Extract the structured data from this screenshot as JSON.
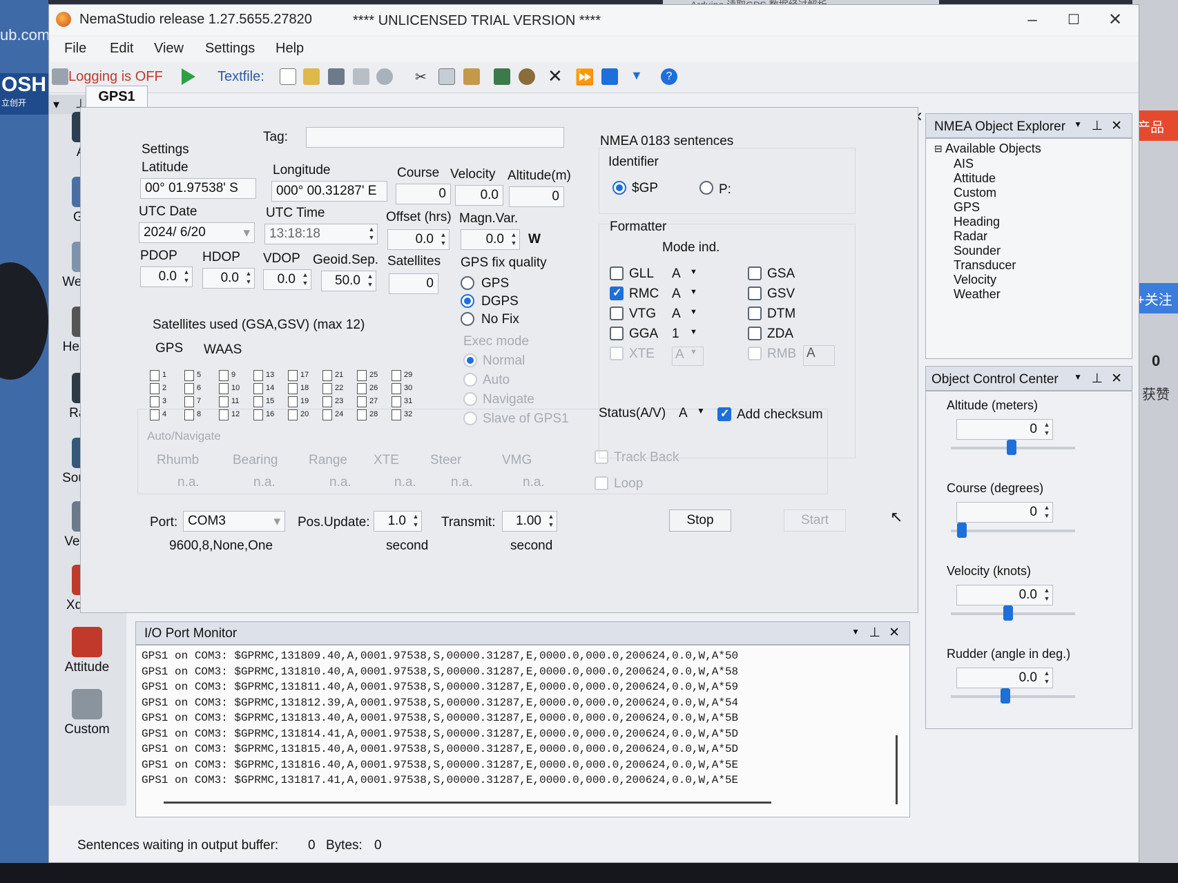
{
  "desktop": {
    "left_text": "ub.com",
    "left_badge": "OSH",
    "left_sub": "立创开",
    "right_badge1": "产品",
    "right_badge2": "+关注",
    "right_count": "0",
    "right_label": "获赞",
    "browser_tab": "Arduino 读取GPS 数据经过解析"
  },
  "window": {
    "title": "NemaStudio release 1.27.5655.27820",
    "trial": "**** UNLICENSED TRIAL VERSION ****",
    "minimize": "–",
    "maximize": "☐",
    "close": "✕"
  },
  "menu": [
    "File",
    "Edit",
    "View",
    "Settings",
    "Help"
  ],
  "toolbar": {
    "logging": "Logging is OFF",
    "textfile": "Textfile:"
  },
  "sidebar": {
    "items": [
      {
        "label": "AIS",
        "icon": "ais-icon",
        "color": "#2c3e50"
      },
      {
        "label": "GPS",
        "icon": "satellite-icon",
        "color": "#4a6fa5"
      },
      {
        "label": "Weather",
        "icon": "cloud-icon",
        "color": "#7f93ad"
      },
      {
        "label": "Heading",
        "icon": "compass-icon",
        "color": "#555"
      },
      {
        "label": "Radar",
        "icon": "radar-icon",
        "color": "#2d3a45"
      },
      {
        "label": "Sounder",
        "icon": "sounder-icon",
        "color": "#35577a"
      },
      {
        "label": "Velocity",
        "icon": "speedometer-icon",
        "color": "#6b7a88"
      },
      {
        "label": "Xducer",
        "icon": "transducer-icon",
        "color": "#c0392b"
      },
      {
        "label": "Attitude",
        "icon": "axes-icon",
        "color": "#c0392b"
      },
      {
        "label": "Custom",
        "icon": "wrench-icon",
        "color": "#8a949e"
      }
    ]
  },
  "gps": {
    "tab": "GPS1",
    "tag_label": "Tag:",
    "settings_label": "Settings",
    "latitude_label": "Latitude",
    "latitude": "00° 01.97538' S",
    "longitude_label": "Longitude",
    "longitude": "000° 00.31287' E",
    "course_label": "Course",
    "course": "0",
    "velocity_label": "Velocity",
    "velocity": "0.0",
    "altitude_label": "Altitude(m)",
    "altitude": "0",
    "utc_date_label": "UTC Date",
    "utc_date": "2024/ 6/20",
    "utc_time_label": "UTC Time",
    "utc_time": "13:18:18",
    "offset_label": "Offset (hrs)",
    "offset": "0.0",
    "magn_label": "Magn.Var.",
    "magn": "0.0",
    "magn_dir": "W",
    "pdop_label": "PDOP",
    "pdop": "0.0",
    "hdop_label": "HDOP",
    "hdop": "0.0",
    "vdop_label": "VDOP",
    "vdop": "0.0",
    "geoid_label": "Geoid.Sep.",
    "geoid": "50.0",
    "sats_label": "Satellites",
    "sats": "0",
    "fix_label": "GPS fix quality",
    "fix_options": [
      "GPS",
      "DGPS",
      "No Fix"
    ],
    "fix_selected": "DGPS",
    "exec_label": "Exec mode",
    "exec_options": [
      "Normal",
      "Auto",
      "Navigate",
      "Slave of GPS1"
    ],
    "sat_used_label": "Satellites used (GSA,GSV) (max 12)",
    "sat_tabs": [
      "GPS",
      "WAAS"
    ],
    "autonav_label": "Auto/Navigate",
    "autonav_cols": [
      "Rhumb",
      "Bearing",
      "Range",
      "XTE",
      "Steer",
      "VMG"
    ],
    "autonav_val": "n.a.",
    "trackback": "Track Back",
    "loop": "Loop",
    "port_label": "Port:",
    "port": "COM3",
    "port_settings": "9600,8,None,One",
    "posupdate_label": "Pos.Update:",
    "posupdate": "1.0",
    "posupdate_unit": "second",
    "transmit_label": "Transmit:",
    "transmit": "1.00",
    "transmit_unit": "second",
    "stop": "Stop",
    "start": "Start"
  },
  "nmea0183": {
    "title": "NMEA 0183 sentences",
    "identifier_label": "Identifier",
    "id_options": [
      "$GP",
      "P:"
    ],
    "id_selected": "$GP",
    "formatter_label": "Formatter",
    "mode_label": "Mode ind.",
    "left": [
      {
        "name": "GLL",
        "checked": false,
        "mode": "A"
      },
      {
        "name": "RMC",
        "checked": true,
        "mode": "A"
      },
      {
        "name": "VTG",
        "checked": false,
        "mode": "A"
      },
      {
        "name": "GGA",
        "checked": false,
        "mode": "1"
      },
      {
        "name": "XTE",
        "checked": false,
        "mode": "A",
        "disabled": true
      }
    ],
    "right": [
      {
        "name": "GSA",
        "checked": false
      },
      {
        "name": "GSV",
        "checked": false
      },
      {
        "name": "DTM",
        "checked": false
      },
      {
        "name": "ZDA",
        "checked": false
      },
      {
        "name": "RMB",
        "checked": false,
        "mode": "A",
        "disabled": true
      }
    ],
    "status_label": "Status(A/V)",
    "status": "A",
    "add_checksum": "Add checksum"
  },
  "explorer": {
    "title": "NMEA Object Explorer",
    "root": "Available Objects",
    "items": [
      "AIS",
      "Attitude",
      "Custom",
      "GPS",
      "Heading",
      "Radar",
      "Sounder",
      "Transducer",
      "Velocity",
      "Weather"
    ]
  },
  "occ": {
    "title": "Object Control Center",
    "controls": [
      {
        "label": "Altitude (meters)",
        "value": "0"
      },
      {
        "label": "Course (degrees)",
        "value": "0"
      },
      {
        "label": "Velocity (knots)",
        "value": "0.0"
      },
      {
        "label": "Rudder (angle in deg.)",
        "value": "0.0"
      }
    ]
  },
  "io": {
    "title": "I/O Port Monitor",
    "lines": [
      "GPS1 on COM3: $GPRMC,131809.40,A,0001.97538,S,00000.31287,E,0000.0,000.0,200624,0.0,W,A*50",
      "GPS1 on COM3: $GPRMC,131810.40,A,0001.97538,S,00000.31287,E,0000.0,000.0,200624,0.0,W,A*58",
      "GPS1 on COM3: $GPRMC,131811.40,A,0001.97538,S,00000.31287,E,0000.0,000.0,200624,0.0,W,A*59",
      "GPS1 on COM3: $GPRMC,131812.39,A,0001.97538,S,00000.31287,E,0000.0,000.0,200624,0.0,W,A*54",
      "GPS1 on COM3: $GPRMC,131813.40,A,0001.97538,S,00000.31287,E,0000.0,000.0,200624,0.0,W,A*5B",
      "GPS1 on COM3: $GPRMC,131814.41,A,0001.97538,S,00000.31287,E,0000.0,000.0,200624,0.0,W,A*5D",
      "GPS1 on COM3: $GPRMC,131815.40,A,0001.97538,S,00000.31287,E,0000.0,000.0,200624,0.0,W,A*5D",
      "GPS1 on COM3: $GPRMC,131816.40,A,0001.97538,S,00000.31287,E,0000.0,000.0,200624,0.0,W,A*5E",
      "GPS1 on COM3: $GPRMC,131817.41,A,0001.97538,S,00000.31287,E,0000.0,000.0,200624,0.0,W,A*5E"
    ]
  },
  "status": {
    "waiting_label": "Sentences waiting in output buffer:",
    "waiting": "0",
    "bytes_label": "Bytes:",
    "bytes": "0"
  }
}
